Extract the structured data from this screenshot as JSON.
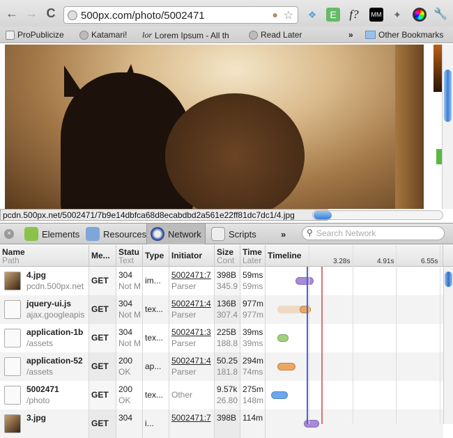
{
  "browser": {
    "url": "500px.com/photo/5002471",
    "back_icon": "arrow-left",
    "forward_icon": "arrow-right",
    "reload_icon": "reload",
    "extensions": [
      "cookie-blocked",
      "star",
      "dropbox",
      "evernote",
      "f?",
      "mm",
      "pin",
      "color-wheel",
      "wrench"
    ]
  },
  "bookmarks": [
    {
      "label": "ProPublicize"
    },
    {
      "label": "Katamari!"
    },
    {
      "label": "Lorem Ipsum - All th"
    },
    {
      "label": "Read Later"
    }
  ],
  "bookmarks_overflow": "»",
  "other_bookmarks": "Other Bookmarks",
  "status_url": "pcdn.500px.net/5002471/7b9e14dbfca68d8ecabdbd2a561e22ff81dc7dc1/4.jpg",
  "devtools": {
    "tabs": [
      {
        "label": "Elements"
      },
      {
        "label": "Resources"
      },
      {
        "label": "Network",
        "active": true
      },
      {
        "label": "Scripts"
      }
    ],
    "overflow": "»",
    "search_placeholder": "Search Network"
  },
  "network": {
    "columns": [
      {
        "title": "Name",
        "sub": "Path"
      },
      {
        "title": "Me..."
      },
      {
        "title": "Statu",
        "sub": "Text"
      },
      {
        "title": "Type"
      },
      {
        "title": "Initiator"
      },
      {
        "title": "Size",
        "sub": "Cont"
      },
      {
        "title": "Time",
        "sub": "Later"
      },
      {
        "title": "Timeline"
      }
    ],
    "timeline_ticks": [
      "3.28s",
      "4.91s",
      "6.55s"
    ],
    "rows": [
      {
        "icon": "image",
        "name": "4.jpg",
        "path": "pcdn.500px.net",
        "method": "GET",
        "status": "304",
        "status_text": "Not M",
        "type": "im...",
        "initiator": "5002471:7",
        "initiator_sub": "Parser",
        "size": "398B",
        "content": "345.9",
        "time": "59ms",
        "latency": "59ms",
        "color": "#a98ad8"
      },
      {
        "icon": "JS",
        "name": "jquery-ui.js",
        "path": "ajax.googleapis",
        "method": "GET",
        "status": "304",
        "status_text": "Not M",
        "type": "tex...",
        "initiator": "5002471:4",
        "initiator_sub": "Parser",
        "size": "136B",
        "content": "307.4",
        "time": "977m",
        "latency": "977m",
        "color": "#e8a868"
      },
      {
        "icon": "CSS",
        "name": "application-1b",
        "path": "/assets",
        "method": "GET",
        "status": "304",
        "status_text": "Not M",
        "type": "tex...",
        "initiator": "5002471:3",
        "initiator_sub": "Parser",
        "size": "225B",
        "content": "188.8",
        "time": "39ms",
        "latency": "39ms",
        "color": "#9fd27a"
      },
      {
        "icon": "JS",
        "name": "application-52",
        "path": "/assets",
        "method": "GET",
        "status": "200",
        "status_text": "OK",
        "type": "ap...",
        "initiator": "5002471:4",
        "initiator_sub": "Parser",
        "size": "50.25",
        "content": "181.8",
        "time": "294m",
        "latency": "74ms",
        "color": "#eda660"
      },
      {
        "icon": "<>",
        "name": "5002471",
        "path": "/photo",
        "method": "GET",
        "status": "200",
        "status_text": "OK",
        "type": "tex...",
        "initiator": "Other",
        "initiator_sub": "",
        "size": "9.57k",
        "content": "26.80",
        "time": "275m",
        "latency": "148m",
        "color": "#6aa8ee"
      },
      {
        "icon": "image",
        "name": "3.jpg",
        "path": "",
        "method": "GET",
        "status": "304",
        "status_text": "",
        "type": "i...",
        "initiator": "5002471:7",
        "initiator_sub": "",
        "size": "398B",
        "content": "",
        "time": "114m",
        "latency": "",
        "color": "#a98ad8"
      }
    ]
  }
}
